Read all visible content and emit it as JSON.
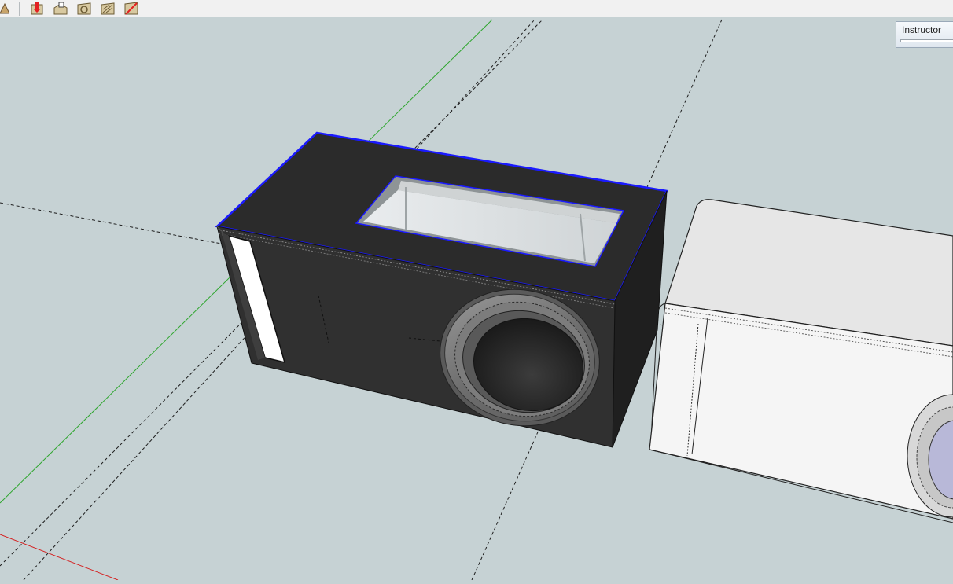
{
  "toolbar": {
    "tools": [
      {
        "name": "warehouse-icon"
      },
      {
        "name": "get-models-icon"
      },
      {
        "name": "share-model-icon"
      },
      {
        "name": "extension-icon"
      },
      {
        "name": "share-component-icon"
      },
      {
        "name": "layout-icon"
      }
    ]
  },
  "instructor": {
    "title": "Instructor"
  },
  "colors": {
    "viewport_background": "#c6d2d4",
    "box_black": "#2c2c2c",
    "selection_blue": "#1a1aff",
    "green_axis": "#2fa62f",
    "red_axis": "#d42020",
    "white_box": "#f4f4f4"
  }
}
